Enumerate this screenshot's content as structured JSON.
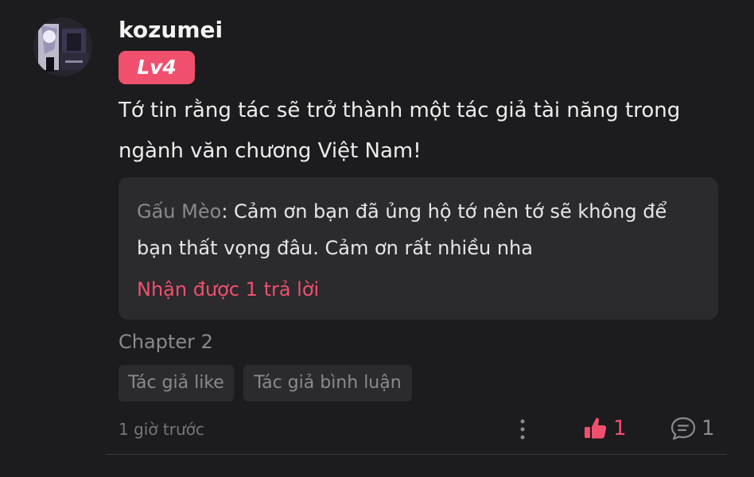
{
  "comment": {
    "username": "kozumei",
    "level": "Lv4",
    "text": "Tớ tin rằng tác sẽ trở thành một tác giả tài năng trong ngành văn chương Việt Nam!",
    "reply": {
      "author": "Gấu Mèo",
      "separator": ":",
      "text": " Cảm ơn bạn đã ủng hộ tớ nên tớ sẽ không để bạn thất vọng đâu. Cảm ơn rất nhiều nha",
      "count_label": "Nhận được 1 trả lời"
    },
    "chapter": "Chapter 2",
    "tags": [
      "Tác giả like",
      "Tác giả bình luận"
    ],
    "timestamp": "1 giờ trước",
    "likes": "1",
    "replies": "1"
  },
  "colors": {
    "background": "#1c1b1d",
    "accent": "#f0506e",
    "panel": "#2b2a2d",
    "muted": "#8a8a8c"
  },
  "icons": {
    "avatar": "avatar",
    "more": "more-vertical-icon",
    "like": "thumbs-up-icon",
    "reply": "chat-bubble-icon"
  }
}
